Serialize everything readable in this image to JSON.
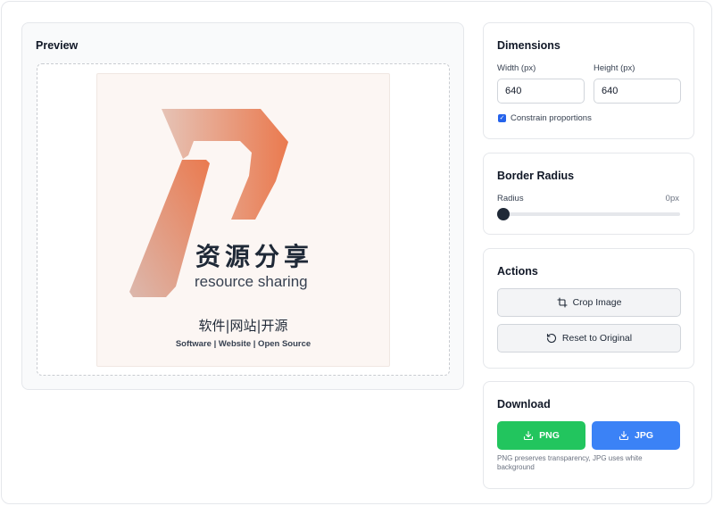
{
  "preview": {
    "title": "Preview",
    "image": {
      "cn_title": "资源分享",
      "en_title": "resource sharing",
      "cn_subtitle": "软件|网站|开源",
      "en_subtitle": "Software | Website | Open Source"
    }
  },
  "dimensions": {
    "title": "Dimensions",
    "width_label": "Width (px)",
    "width_value": "640",
    "height_label": "Height (px)",
    "height_value": "640",
    "constrain_label": "Constrain proportions",
    "constrain_checked": true
  },
  "border_radius": {
    "title": "Border Radius",
    "radius_label": "Radius",
    "radius_value_text": "0px",
    "radius_value": 0
  },
  "actions": {
    "title": "Actions",
    "crop_label": "Crop Image",
    "crop_icon": "crop-icon",
    "reset_label": "Reset to Original",
    "reset_icon": "rotate-ccw-icon"
  },
  "download": {
    "title": "Download",
    "png_label": "PNG",
    "jpg_label": "JPG",
    "download_icon": "download-icon",
    "png_color": "#22c55e",
    "jpg_color": "#3b82f6",
    "note": "PNG preserves transparency, JPG uses white background"
  },
  "colors": {
    "accent_blue": "#2563eb",
    "logo_gradient_start": "#dcb8ad",
    "logo_gradient_end": "#ea7a4f"
  }
}
